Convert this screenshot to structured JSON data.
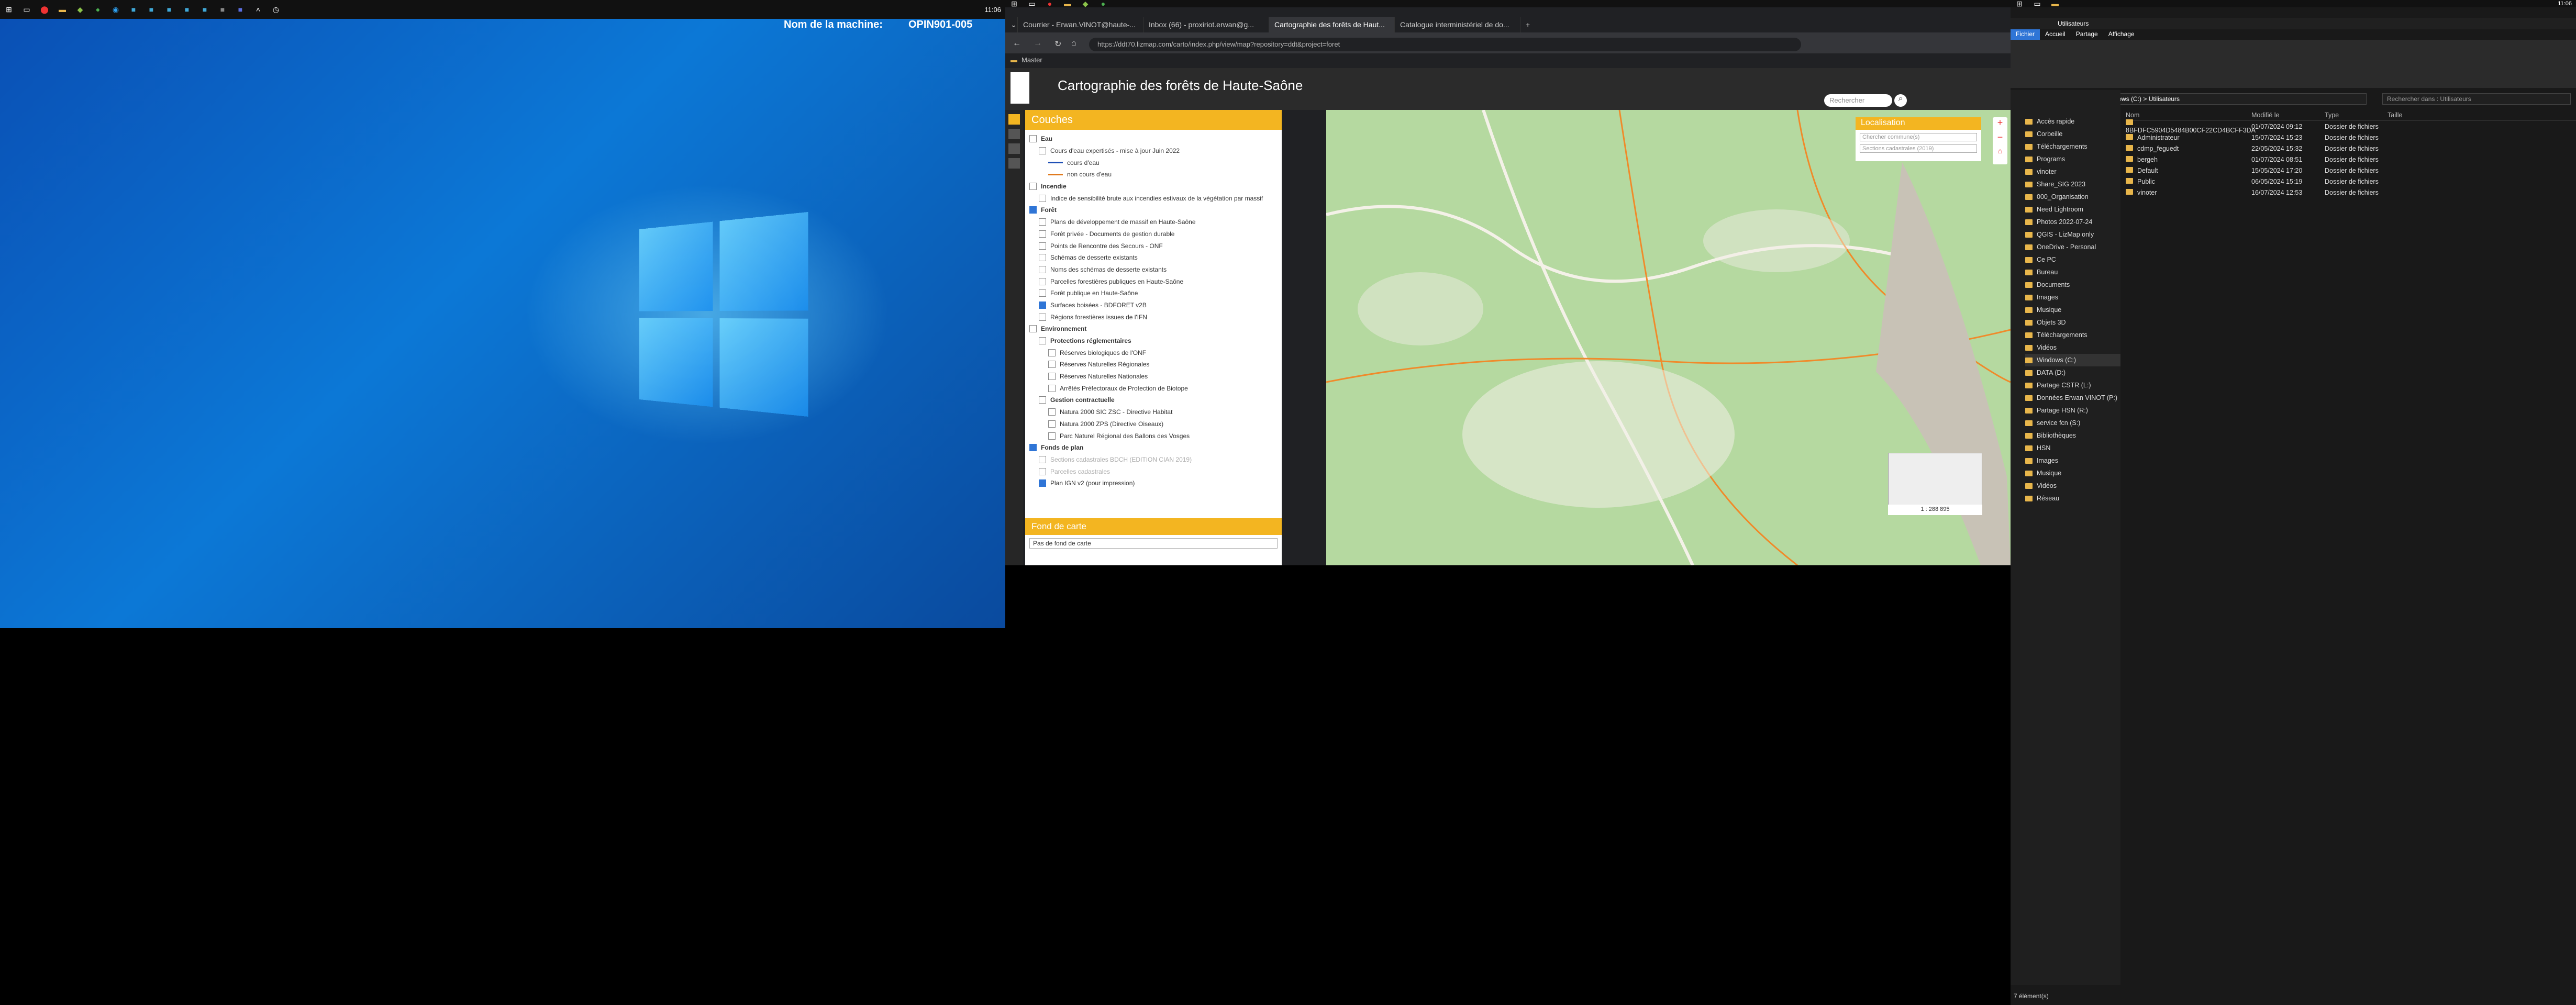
{
  "monitor1": {
    "clock": "11:06",
    "machine_label": "Nom de la machine:",
    "machine_name": "OPIN901-005"
  },
  "browser": {
    "tabs": [
      "Courrier - Erwan.VINOT@haute-...",
      "Inbox (66) - proxiriot.erwan@g...",
      "Cartographie des forêts de Haut...",
      "Catalogue interministériel de do..."
    ],
    "url": "https://ddt70.lizmap.com/carto/index.php/view/map?repository=ddt&project=foret",
    "bookmark_folder": "Master",
    "page_title": "Cartographie des forêts de Haute-Saône",
    "layers_title": "Couches",
    "fond_title": "Fond de carte",
    "fond_value": "Pas de fond de carte",
    "search_placeholder": "Rechercher",
    "localisation_title": "Localisation",
    "commune_placeholder": "Chercher commune(s)",
    "sections_placeholder": "Sections cadastrales (2019)",
    "scale": "1 : 288 895",
    "layers": [
      {
        "label": "Eau",
        "checked": false,
        "indent": 0,
        "bold": true
      },
      {
        "label": "Cours d'eau expertisés - mise à jour Juin 2022",
        "checked": false,
        "indent": 1
      },
      {
        "label": "cours d'eau",
        "checked": null,
        "indent": 2,
        "legend": "#1e4fb5"
      },
      {
        "label": "non cours d'eau",
        "checked": null,
        "indent": 2,
        "legend": "#e07a1e"
      },
      {
        "label": "Incendie",
        "checked": false,
        "indent": 0,
        "bold": true
      },
      {
        "label": "Indice de sensibilité brute aux incendies estivaux de la végétation par massif",
        "checked": false,
        "indent": 1
      },
      {
        "label": "Forêt",
        "checked": true,
        "indent": 0,
        "bold": true
      },
      {
        "label": "Plans de développement de massif en Haute-Saône",
        "checked": false,
        "indent": 1
      },
      {
        "label": "Forêt privée - Documents de gestion durable",
        "checked": false,
        "indent": 1
      },
      {
        "label": "Points de Rencontre des Secours - ONF",
        "checked": false,
        "indent": 1
      },
      {
        "label": "Schémas de desserte existants",
        "checked": false,
        "indent": 1
      },
      {
        "label": "Noms des schémas de desserte existants",
        "checked": false,
        "indent": 1
      },
      {
        "label": "Parcelles forestières publiques en Haute-Saône",
        "checked": false,
        "indent": 1
      },
      {
        "label": "Forêt publique en Haute-Saône",
        "checked": false,
        "indent": 1
      },
      {
        "label": "Surfaces boisées - BDFORET v2B",
        "checked": true,
        "indent": 1
      },
      {
        "label": "Régions forestières issues de l'IFN",
        "checked": false,
        "indent": 1
      },
      {
        "label": "Environnement",
        "checked": false,
        "indent": 0,
        "bold": true
      },
      {
        "label": "Protections réglementaires",
        "checked": false,
        "indent": 1,
        "bold": true
      },
      {
        "label": "Réserves biologiques de l'ONF",
        "checked": false,
        "indent": 2
      },
      {
        "label": "Réserves Naturelles Régionales",
        "checked": false,
        "indent": 2
      },
      {
        "label": "Réserves Naturelles Nationales",
        "checked": false,
        "indent": 2
      },
      {
        "label": "Arrêtés Préfectoraux de Protection de Biotope",
        "checked": false,
        "indent": 2
      },
      {
        "label": "Gestion contractuelle",
        "checked": false,
        "indent": 1,
        "bold": true
      },
      {
        "label": "Natura 2000 SIC ZSC - Directive Habitat",
        "checked": false,
        "indent": 2
      },
      {
        "label": "Natura 2000 ZPS (Directive Oiseaux)",
        "checked": false,
        "indent": 2
      },
      {
        "label": "Parc Naturel Régional des Ballons des Vosges",
        "checked": false,
        "indent": 2
      },
      {
        "label": "Fonds de plan",
        "checked": true,
        "indent": 0,
        "bold": true
      },
      {
        "label": "Sections cadastrales BDCH (EDITION CIAN 2019)",
        "checked": false,
        "indent": 1,
        "grey": true
      },
      {
        "label": "Parcelles cadastrales",
        "checked": false,
        "indent": 1,
        "grey": true
      },
      {
        "label": "Plan IGN v2 (pour impression)",
        "checked": true,
        "indent": 1
      }
    ]
  },
  "explorer": {
    "title": "Utilisateurs",
    "ribbon_tabs": [
      "Fichier",
      "Accueil",
      "Partage",
      "Affichage"
    ],
    "breadcrumb": "Ce PC  >  Windows (C:)  >  Utilisateurs",
    "search_placeholder": "Rechercher dans : Utilisateurs",
    "columns": [
      "Nom",
      "Modifié le",
      "Type",
      "Taille"
    ],
    "files": [
      {
        "name": "8BFDFC5904D5484B00CF22CD4BCFF3DA",
        "date": "01/07/2024 09:12",
        "type": "Dossier de fichiers"
      },
      {
        "name": "Administrateur",
        "date": "15/07/2024 15:23",
        "type": "Dossier de fichiers"
      },
      {
        "name": "cdmp_feguedt",
        "date": "22/05/2024 15:32",
        "type": "Dossier de fichiers"
      },
      {
        "name": "bergeh",
        "date": "01/07/2024 08:51",
        "type": "Dossier de fichiers"
      },
      {
        "name": "Default",
        "date": "15/05/2024 17:20",
        "type": "Dossier de fichiers"
      },
      {
        "name": "Public",
        "date": "06/05/2024 15:19",
        "type": "Dossier de fichiers"
      },
      {
        "name": "vinoter",
        "date": "16/07/2024 12:53",
        "type": "Dossier de fichiers"
      }
    ],
    "nav": [
      "Accès rapide",
      "Corbeille",
      "Téléchargements",
      "Programs",
      "vinoter",
      "Share_SIG 2023",
      "000_Organisation",
      "Need Lightroom",
      "Photos 2022-07-24",
      "QGIS - LizMap only",
      "OneDrive - Personal",
      "Ce PC",
      "Bureau",
      "Documents",
      "Images",
      "Musique",
      "Objets 3D",
      "Téléchargements",
      "Vidéos",
      "Windows (C:)",
      "DATA (D:)",
      "Partage CSTR (L:)",
      "Données Erwan VINOT (P:)",
      "Partage HSN (R:)",
      "service fcn (S:)",
      "Bibliothèques",
      "HSN",
      "Images",
      "Musique",
      "Vidéos",
      "Réseau"
    ],
    "status": "7 élément(s)",
    "clock": "11:06"
  }
}
